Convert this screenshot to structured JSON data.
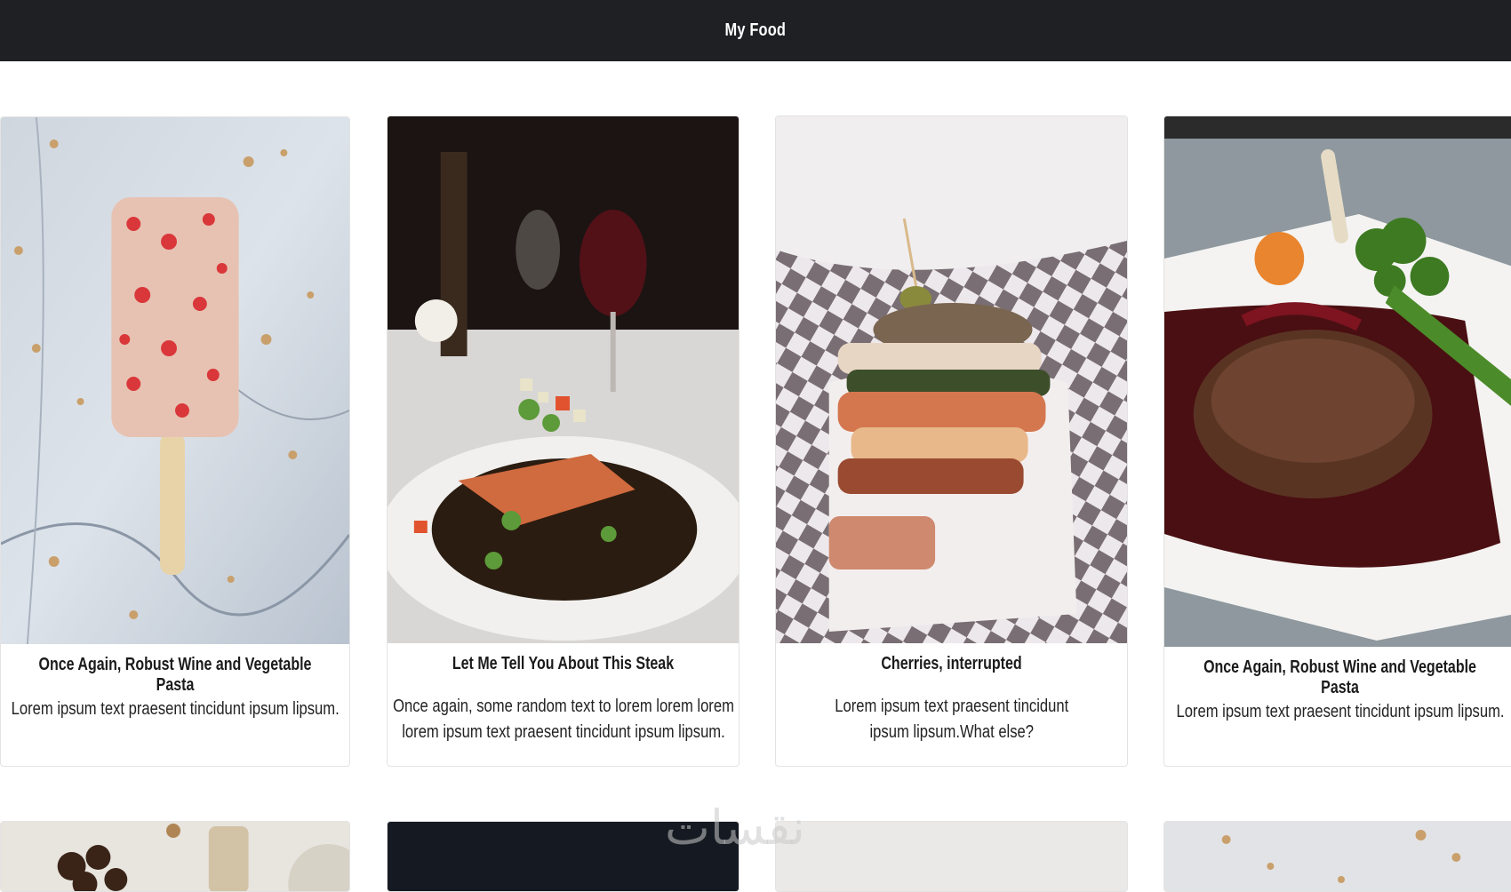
{
  "header": {
    "brand": "My Food"
  },
  "cards": [
    {
      "title": "Once Again, Robust Wine and Vegetable Pasta",
      "text": "Lorem ipsum text praesent tincidunt ipsum lipsum.",
      "image": "popsicle-photo"
    },
    {
      "title": "Let Me Tell You About This Steak",
      "text": "Once again, some random text to lorem lorem lorem lorem ipsum text praesent tincidunt ipsum lipsum.",
      "image": "salmon-dish-photo"
    },
    {
      "title": "Cherries, interrupted",
      "text": "Lorem ipsum text praesent tincidunt ipsum lipsum.What else?",
      "image": "sandwich-photo"
    },
    {
      "title": "Once Again, Robust Wine and Vegetable Pasta",
      "text": "Lorem ipsum text praesent tincidunt ipsum lipsum.",
      "image": "steak-plate-photo"
    }
  ],
  "second_row": [
    {
      "image": "dates-table-photo"
    },
    {
      "image": "dark-food-photo"
    },
    {
      "image": "bright-food-photo"
    },
    {
      "image": "crumbs-photo"
    }
  ],
  "watermark": "نقسات",
  "colors": {
    "navbar": "#1e2023",
    "card_border": "#e3e3e3"
  }
}
